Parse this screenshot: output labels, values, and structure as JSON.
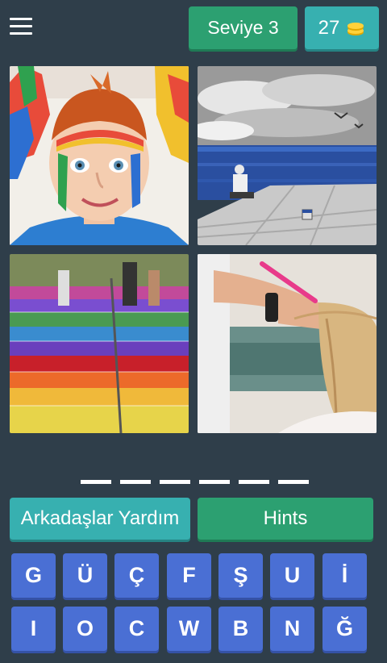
{
  "header": {
    "level_label": "Seviye 3",
    "coins": "27",
    "coin_icon": "coin-stack-icon"
  },
  "images": [
    {
      "name": "boy-painted-face"
    },
    {
      "name": "painter-blue-sea"
    },
    {
      "name": "rainbow-stairs"
    },
    {
      "name": "hair-dyeing"
    }
  ],
  "answer": {
    "slots": 6
  },
  "actions": {
    "friends_label": "Arkadaşlar Yardım",
    "hints_label": "Hints"
  },
  "keyboard": {
    "row1": [
      "G",
      "Ü",
      "Ç",
      "F",
      "Ş",
      "U",
      "İ"
    ],
    "row2": [
      "I",
      "O",
      "C",
      "W",
      "B",
      "N",
      "Ğ"
    ]
  },
  "colors": {
    "background": "#2f3e4a",
    "green": "#2ca071",
    "teal": "#37b0b0",
    "key_blue": "#4a6fd4"
  }
}
